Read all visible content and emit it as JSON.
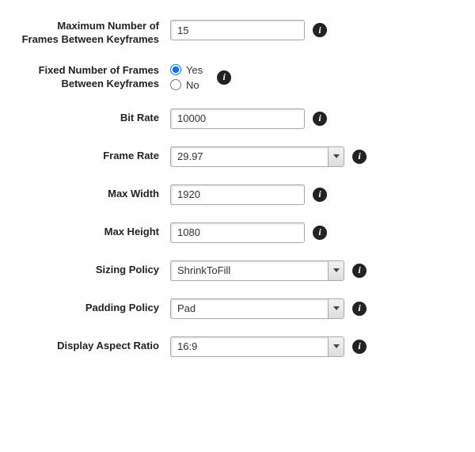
{
  "fields": {
    "maxFramesBetween": {
      "label": "Maximum Number of Frames Between Keyframes",
      "value": "15"
    },
    "fixedFrames": {
      "label": "Fixed Number of Frames Between Keyframes",
      "yes": "Yes",
      "no": "No",
      "selected": "yes"
    },
    "bitRate": {
      "label": "Bit Rate",
      "value": "10000"
    },
    "frameRate": {
      "label": "Frame Rate",
      "value": "29.97"
    },
    "maxWidth": {
      "label": "Max Width",
      "value": "1920"
    },
    "maxHeight": {
      "label": "Max Height",
      "value": "1080"
    },
    "sizingPolicy": {
      "label": "Sizing Policy",
      "value": "ShrinkToFill"
    },
    "paddingPolicy": {
      "label": "Padding Policy",
      "value": "Pad"
    },
    "displayAspectRatio": {
      "label": "Display Aspect Ratio",
      "value": "16:9"
    }
  }
}
